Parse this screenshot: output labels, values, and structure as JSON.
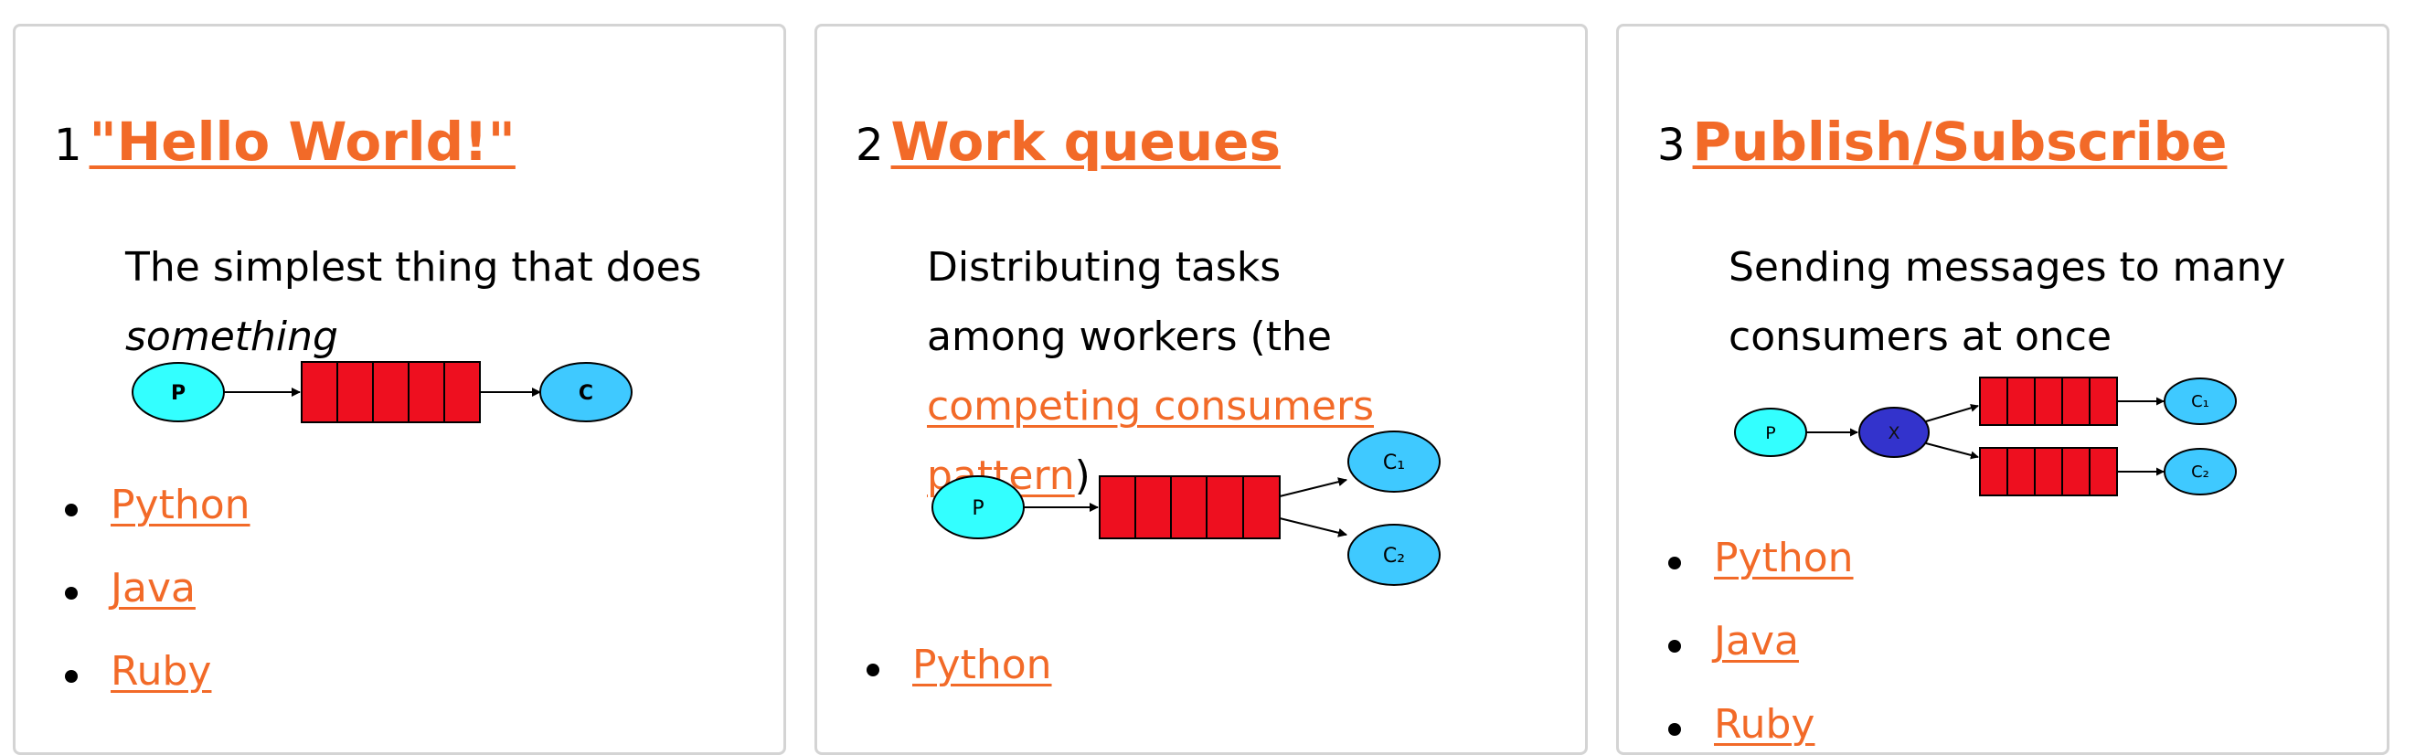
{
  "tutorials": [
    {
      "number": "1",
      "title": "\"Hello World!\"",
      "description": {
        "text": "The simplest thing that does",
        "emphasis": "something"
      },
      "diagram": {
        "producer": "P",
        "consumer": "C"
      },
      "languages": [
        "Python",
        "Java",
        "Ruby"
      ]
    },
    {
      "number": "2",
      "title": "Work queues",
      "description": {
        "before": "Distributing tasks among workers (the ",
        "link": "competing consumers pattern",
        "after": ")"
      },
      "diagram": {
        "producer": "P",
        "consumer_1": "C₁",
        "consumer_2": "C₂"
      },
      "languages": [
        "Python"
      ]
    },
    {
      "number": "3",
      "title": "Publish/Subscribe",
      "description": {
        "text": "Sending messages to many consumers at once"
      },
      "diagram": {
        "producer": "P",
        "exchange": "X",
        "consumer_1": "C₁",
        "consumer_2": "C₂"
      },
      "languages": [
        "Python",
        "Java",
        "Ruby"
      ]
    }
  ],
  "colors": {
    "link": "#f26a28",
    "producer": "#33ffff",
    "consumer": "#3fc9ff",
    "queue": "#ee0f1f",
    "exchange": "#3333cc",
    "card_border": "#d4d4d4"
  }
}
